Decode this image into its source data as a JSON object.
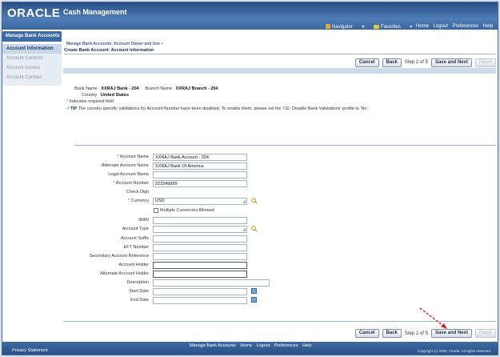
{
  "header": {
    "logo": "ORACLE",
    "app_title": "Cash Management",
    "navigator_label": "Navigator",
    "favorites_label": "Favorites",
    "global_links": [
      "Home",
      "Logout",
      "Preferences",
      "Help"
    ]
  },
  "left_nav": {
    "tab_label": "Manage Bank Accounts",
    "items": [
      {
        "label": "Account Information",
        "active": true
      },
      {
        "label": "Account Controls",
        "active": false
      },
      {
        "label": "Account Access",
        "active": false
      },
      {
        "label": "Account Contact",
        "active": false
      }
    ]
  },
  "page": {
    "breadcrumb": "Manage Bank Accounts: Account Owner and Use",
    "breadcrumb_sep": ">",
    "title": "Create Bank Account: Account Information",
    "buttons": {
      "cancel": "Cancel",
      "back": "Back",
      "save_next": "Save and Next",
      "finish": "Finish"
    },
    "step_text": "Step 2 of 5"
  },
  "info": {
    "bank_name_label": "Bank Name",
    "bank_name_value": "XXRAJ Bank - 204",
    "branch_name_label": "Branch Name",
    "branch_name_value": "XXRAJ Branch - 204",
    "country_label": "Country",
    "country_value": "United States",
    "required_note": "Indicates required field",
    "tip_label": "TIP",
    "tip_text": "The country-specific validations for Account Number have been disabled. To enable them, please set the 'CE: Disable Bank Validations' profile to 'No'."
  },
  "form": {
    "account_name": {
      "label": "Account Name",
      "value": "XXRAJ Bank Account - 204"
    },
    "alternate_account_name": {
      "label": "Alternate Account Name",
      "value": "XXRAJ Bank Of America"
    },
    "legal_account_name": {
      "label": "Legal Account Name",
      "value": ""
    },
    "account_number": {
      "label": "Account Number",
      "value": "223349999"
    },
    "check_digit": {
      "label": "Check Digit",
      "value": ""
    },
    "currency": {
      "label": "Currency",
      "value": "USD"
    },
    "multiple_currencies": {
      "label": "Multiple Currencies Allowed",
      "checked": false
    },
    "iban": {
      "label": "IBAN",
      "value": ""
    },
    "account_type": {
      "label": "Account Type",
      "value": ""
    },
    "account_suffix": {
      "label": "Account Suffix",
      "value": ""
    },
    "eft_number": {
      "label": "EFT Number",
      "value": ""
    },
    "secondary_account_reference": {
      "label": "Secondary Account Reference",
      "value": ""
    },
    "account_holder": {
      "label": "Account Holder",
      "value": ""
    },
    "alternate_account_holder": {
      "label": "Alternate Account Holder",
      "value": ""
    },
    "description": {
      "label": "Description",
      "value": ""
    },
    "start_date": {
      "label": "Start Date",
      "value": ""
    },
    "end_date": {
      "label": "End Date",
      "value": ""
    }
  },
  "footer": {
    "links": [
      "Manage Bank Accounts",
      "Home",
      "Logout",
      "Preferences",
      "Help"
    ],
    "privacy": "Privacy Statement",
    "copyright": "Copyright (c) 2006, Oracle. All rights reserved."
  },
  "colors": {
    "header_blue": "#3b679f",
    "annotation_arrow": "#d8141b"
  }
}
